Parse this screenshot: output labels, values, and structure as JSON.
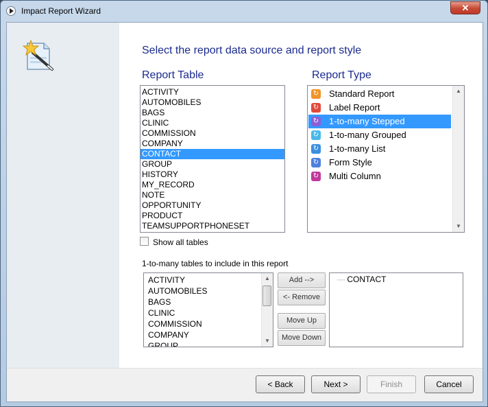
{
  "window": {
    "title": "Impact Report Wizard",
    "close_glyph": "✕"
  },
  "heading": "Select the report data source and report style",
  "report_table": {
    "label": "Report Table",
    "items": [
      "ACTIVITY",
      "AUTOMOBILES",
      "BAGS",
      "CLINIC",
      "COMMISSION",
      "COMPANY",
      "CONTACT",
      "GROUP",
      "HISTORY",
      "MY_RECORD",
      "NOTE",
      "OPPORTUNITY",
      "PRODUCT",
      "TEAMSUPPORTPHONESET"
    ],
    "selected": "CONTACT"
  },
  "report_type": {
    "label": "Report Type",
    "items": [
      {
        "label": "Standard Report",
        "icon": "standard-report-icon",
        "color": "#f0932b"
      },
      {
        "label": "Label Report",
        "icon": "label-report-icon",
        "color": "#e04a3c"
      },
      {
        "label": "1-to-many Stepped",
        "icon": "stepped-report-icon",
        "color": "#8b5fd6"
      },
      {
        "label": "1-to-many Grouped",
        "icon": "grouped-report-icon",
        "color": "#4ab8e8"
      },
      {
        "label": "1-to-many List",
        "icon": "list-report-icon",
        "color": "#3a8fe0"
      },
      {
        "label": "Form Style",
        "icon": "form-style-icon",
        "color": "#4d7fe0"
      },
      {
        "label": "Multi Column",
        "icon": "multi-column-icon",
        "color": "#c0399b"
      }
    ],
    "selected": "1-to-many Stepped"
  },
  "show_all_tables": {
    "label": "Show all tables",
    "checked": false
  },
  "one_to_many": {
    "label": "1-to-many tables to include in this report",
    "available": [
      "ACTIVITY",
      "AUTOMOBILES",
      "BAGS",
      "CLINIC",
      "COMMISSION",
      "COMPANY",
      "GROUP"
    ],
    "included_tree": "CONTACT"
  },
  "transfer_buttons": {
    "add": "Add -->",
    "remove": "<- Remove",
    "move_up": "Move Up",
    "move_down": "Move Down"
  },
  "footer": {
    "back": "< Back",
    "next": "Next >",
    "finish": "Finish",
    "cancel": "Cancel"
  },
  "colors": {
    "heading": "#1a2a8e",
    "selection": "#3399ff"
  }
}
